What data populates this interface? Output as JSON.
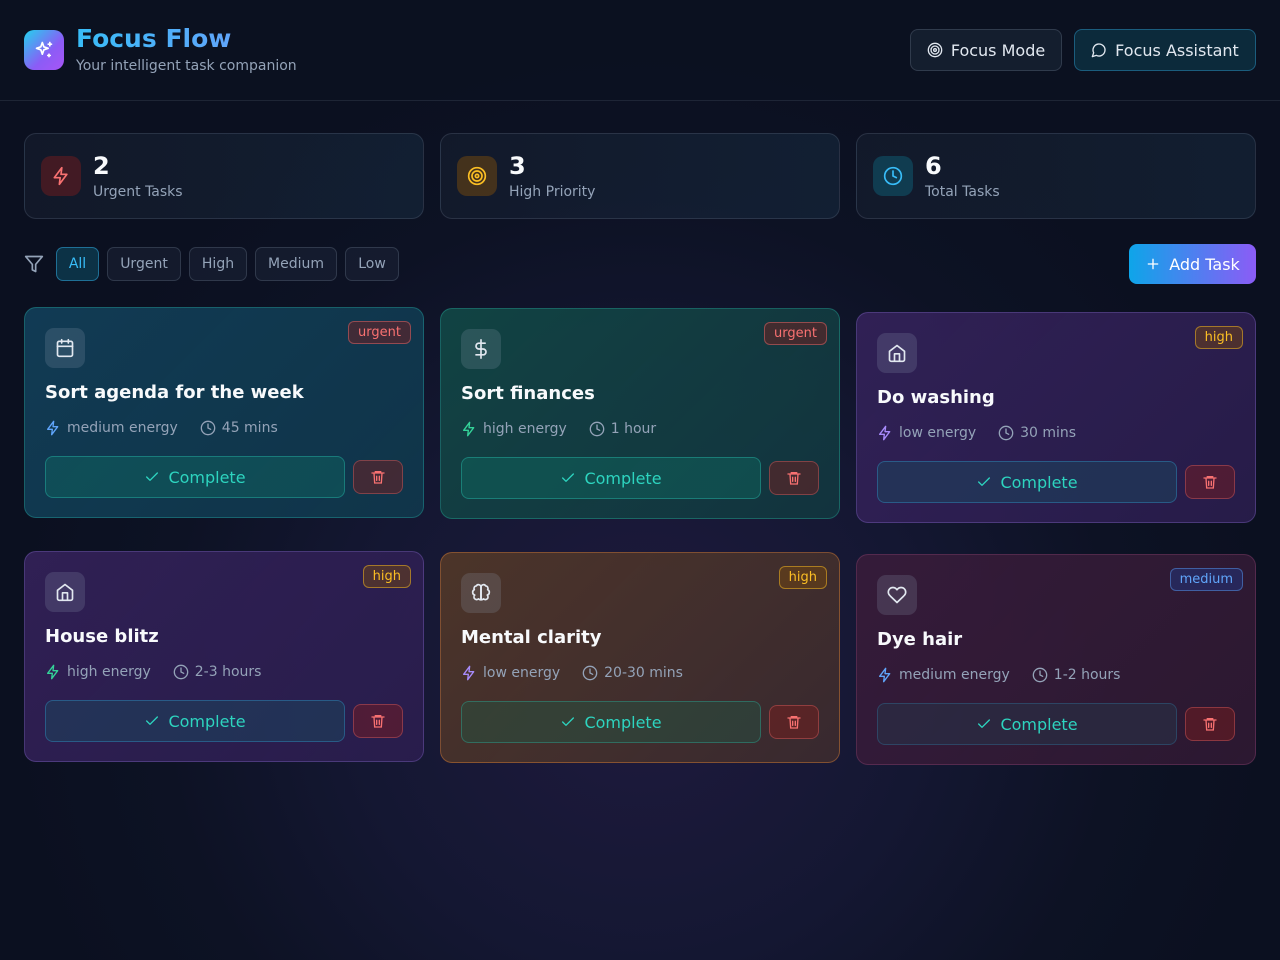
{
  "header": {
    "title": "Focus Flow",
    "subtitle": "Your intelligent task companion",
    "focus_mode_label": "Focus Mode",
    "assistant_label": "Focus Assistant"
  },
  "stats": [
    {
      "value": "2",
      "label": "Urgent Tasks",
      "icon": "lightning-icon",
      "color": "#f87171"
    },
    {
      "value": "3",
      "label": "High Priority",
      "icon": "target-icon",
      "color": "#fbbf24"
    },
    {
      "value": "6",
      "label": "Total Tasks",
      "icon": "clock-icon",
      "color": "#38bdf8"
    }
  ],
  "filters": {
    "icon": "filter-icon",
    "options": [
      "All",
      "Urgent",
      "High",
      "Medium",
      "Low"
    ],
    "selected": "All"
  },
  "add_task_label": "Add Task",
  "tasks": [
    {
      "title": "Sort agenda for the week",
      "priority": "urgent",
      "energy": "medium energy",
      "duration": "45 mins",
      "icon": "calendar-icon",
      "complete_label": "Complete"
    },
    {
      "title": "Sort finances",
      "priority": "urgent",
      "energy": "high energy",
      "duration": "1 hour",
      "icon": "dollar-icon",
      "complete_label": "Complete"
    },
    {
      "title": "Do washing",
      "priority": "high",
      "energy": "low energy",
      "duration": "30 mins",
      "icon": "home-icon",
      "complete_label": "Complete"
    },
    {
      "title": "House blitz",
      "priority": "high",
      "energy": "high energy",
      "duration": "2-3 hours",
      "icon": "home-icon",
      "complete_label": "Complete"
    },
    {
      "title": "Mental clarity",
      "priority": "high",
      "energy": "low energy",
      "duration": "20-30 mins",
      "icon": "brain-icon",
      "complete_label": "Complete"
    },
    {
      "title": "Dye hair",
      "priority": "medium",
      "energy": "medium energy",
      "duration": "1-2 hours",
      "icon": "heart-icon",
      "complete_label": "Complete"
    }
  ],
  "colors": {
    "accent": "#38bdf8",
    "brand_gradient_start": "#0ea5e9",
    "brand_gradient_end": "#8b5cf6",
    "complete_text": "#2dd4bf",
    "delete": "#f87171"
  }
}
